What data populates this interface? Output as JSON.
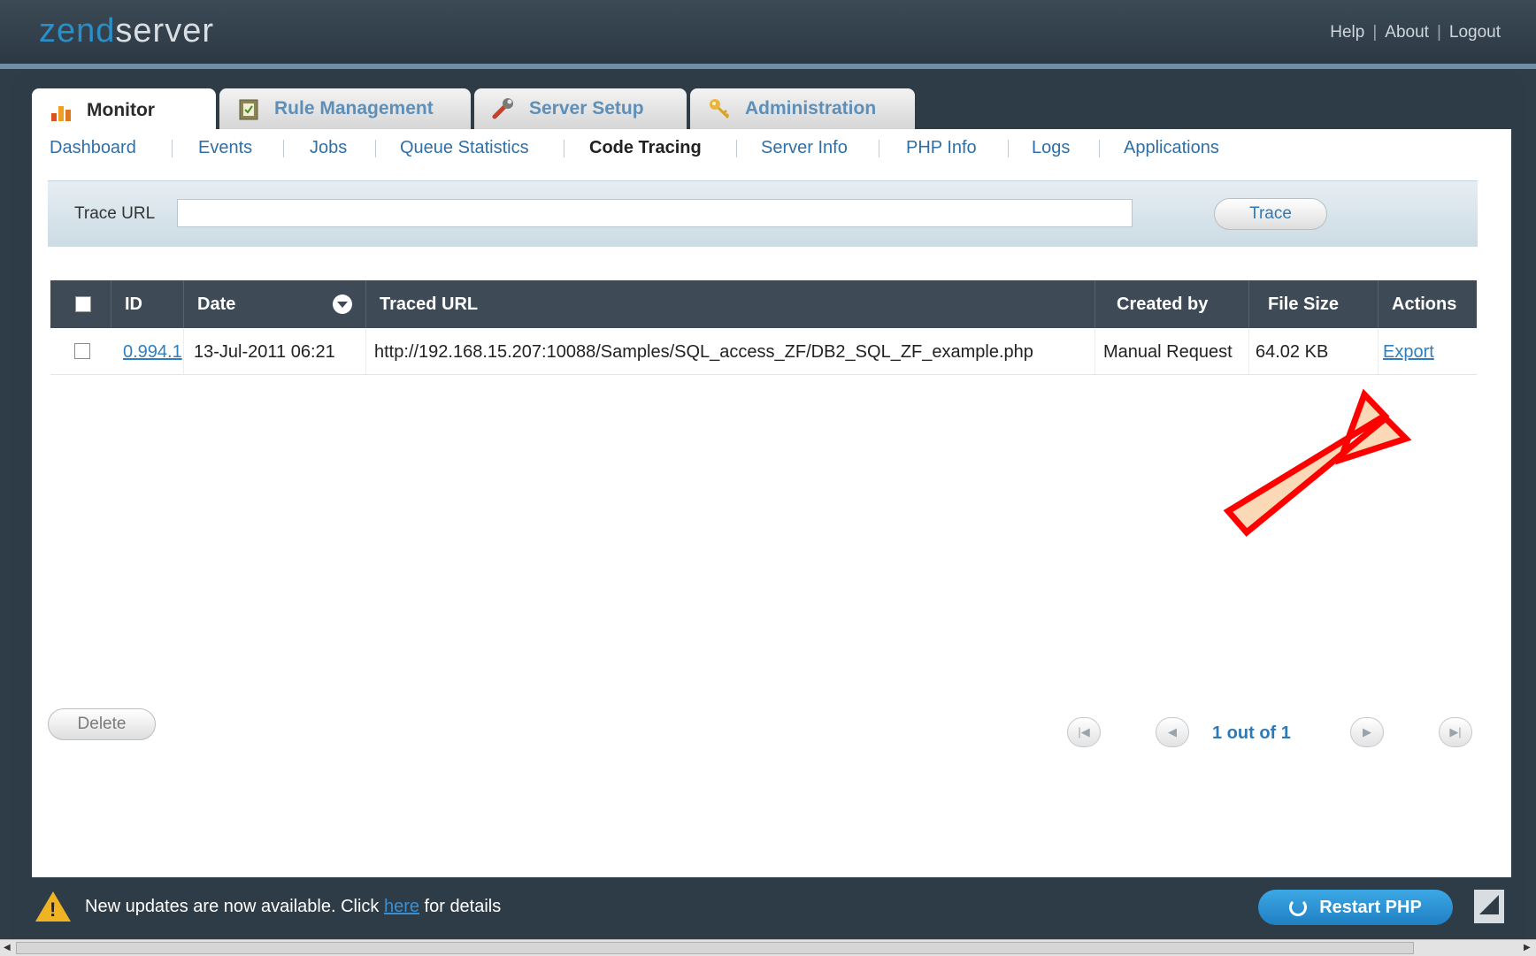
{
  "header": {
    "logo_brand": "zend",
    "logo_product": "server",
    "links": [
      "Help",
      "About",
      "Logout"
    ]
  },
  "tabs": [
    {
      "label": "Monitor",
      "icon": "bar-chart-icon",
      "active": true
    },
    {
      "label": "Rule Management",
      "icon": "clipboard-icon",
      "active": false
    },
    {
      "label": "Server Setup",
      "icon": "wrench-icon",
      "active": false
    },
    {
      "label": "Administration",
      "icon": "key-icon",
      "active": false
    }
  ],
  "subnav": [
    {
      "label": "Dashboard"
    },
    {
      "label": "Events"
    },
    {
      "label": "Jobs"
    },
    {
      "label": "Queue Statistics"
    },
    {
      "label": "Code Tracing",
      "current": true
    },
    {
      "label": "Server Info"
    },
    {
      "label": "PHP Info"
    },
    {
      "label": "Logs"
    },
    {
      "label": "Applications"
    }
  ],
  "trace": {
    "label": "Trace URL",
    "value": "",
    "button": "Trace"
  },
  "table": {
    "columns": [
      "ID",
      "Date",
      "Traced URL",
      "Created by",
      "File Size",
      "Actions"
    ],
    "rows": [
      {
        "id": "0.994.1",
        "date": "13-Jul-2011 06:21",
        "url": "http://192.168.15.207:10088/Samples/SQL_access_ZF/DB2_SQL_ZF_example.php",
        "created_by": "Manual Request",
        "file_size": "64.02 KB",
        "action": "Export"
      }
    ]
  },
  "controls": {
    "delete": "Delete",
    "pager_text": "1 out of 1",
    "pager_first": "|◀",
    "pager_prev": "◀",
    "pager_next": "▶",
    "pager_last": "▶|"
  },
  "footer": {
    "msg_before": "New updates are now available. Click ",
    "msg_link": "here",
    "msg_after": " for details",
    "restart": "Restart PHP"
  },
  "colors": {
    "header_bg": "#2e3c47",
    "link_blue": "#2f7fc0",
    "table_head_bg": "#3e4a55",
    "restart_blue": "#1f7fc2",
    "warning_yellow": "#f0b323",
    "annotation_red": "#ff0000",
    "annotation_fill": "#fbd9b6"
  }
}
